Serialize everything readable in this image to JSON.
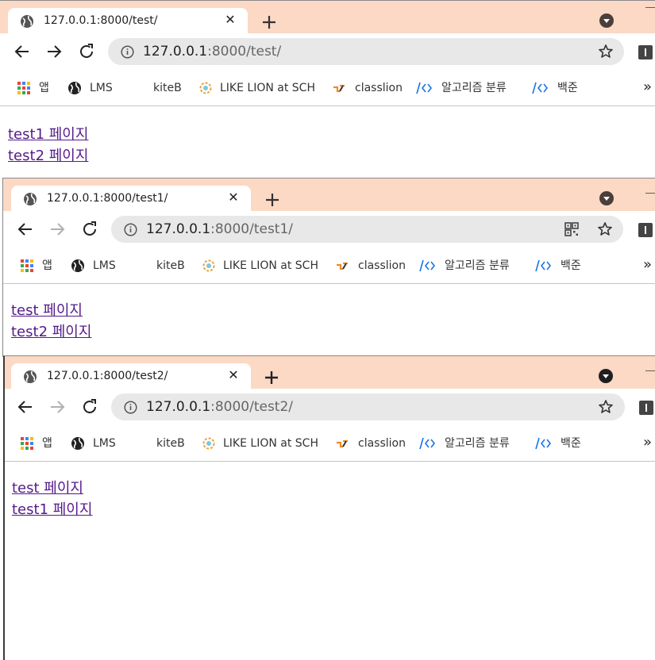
{
  "colors": {
    "tabstrip_bg": "#fbd9c5",
    "visited_link": "#551a8b",
    "bookmark_code_icon": "#1a73e8"
  },
  "bookmarks": [
    {
      "label": "앱",
      "icon": "apps-grid-icon"
    },
    {
      "label": "LMS",
      "icon": "globe-icon"
    },
    {
      "label": "kiteB",
      "icon": "none"
    },
    {
      "label": "LIKE LION at SCH",
      "icon": "lion-logo-icon"
    },
    {
      "label": "classlion",
      "icon": "classlion-logo-icon"
    },
    {
      "label": "알고리즘 분류",
      "icon": "code-brackets-icon"
    },
    {
      "label": "백준",
      "icon": "code-brackets-icon"
    }
  ],
  "bookmarks_more": "»",
  "windows": [
    {
      "tab_title": "127.0.0.1:8000/test/",
      "url_host": "127.0.0.1",
      "url_rest": ":8000/test/",
      "forward_enabled": true,
      "links": [
        "test1 페이지",
        "test2 페이지"
      ]
    },
    {
      "tab_title": "127.0.0.1:8000/test1/",
      "url_host": "127.0.0.1",
      "url_rest": ":8000/test1/",
      "forward_enabled": false,
      "links": [
        "test 페이지",
        "test2 페이지"
      ]
    },
    {
      "tab_title": "127.0.0.1:8000/test2/",
      "url_host": "127.0.0.1",
      "url_rest": ":8000/test2/",
      "forward_enabled": false,
      "links": [
        "test 페이지",
        "test1 페이지"
      ]
    }
  ]
}
